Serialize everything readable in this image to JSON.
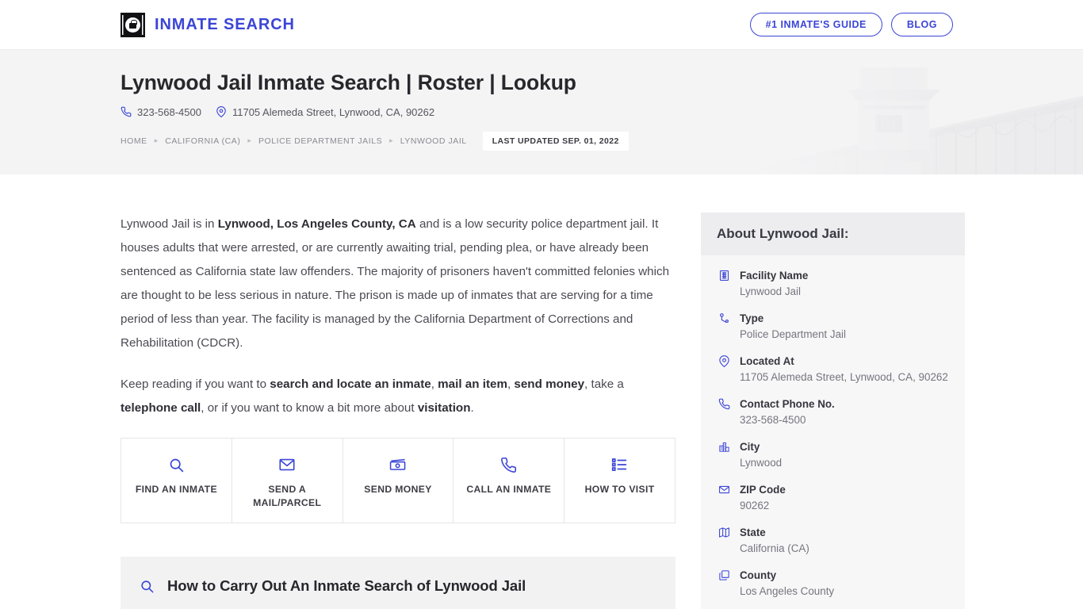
{
  "header": {
    "brand_name": "INMATE SEARCH",
    "logo_icon": "jail-bars-padlock-icon",
    "buttons": [
      {
        "label": "#1 INMATE'S GUIDE",
        "name": "inmates-guide-button"
      },
      {
        "label": "BLOG",
        "name": "blog-button"
      }
    ]
  },
  "hero": {
    "title": "Lynwood Jail Inmate Search | Roster | Lookup",
    "phone_icon": "phone-icon",
    "phone": "323-568-4500",
    "location_icon": "map-pin-icon",
    "address": "11705 Alemeda Street, Lynwood, CA, 90262",
    "breadcrumbs": [
      "HOME",
      "CALIFORNIA (CA)",
      "POLICE DEPARTMENT JAILS",
      "LYNWOOD JAIL"
    ],
    "separator": "▸",
    "last_updated": "LAST UPDATED SEP. 01, 2022",
    "background_art": "prison-watchtower-fence-image"
  },
  "main": {
    "paragraph1": {
      "p1": "Lynwood Jail is in ",
      "b1": "Lynwood, Los Angeles County, CA",
      "p2": " and is a low security police department jail. It houses adults that were arrested, or are currently awaiting trial, pending plea, or have already been sentenced as California state law offenders. The majority of prisoners haven't committed felonies which are thought to be less serious in nature. The prison is made up of inmates that are serving for a time period of less than year. The facility is managed by the California Department of Corrections and Rehabilitation (CDCR)."
    },
    "paragraph2": {
      "p1": "Keep reading if you want to ",
      "b1": "search and locate an inmate",
      "p2": ", ",
      "b2": "mail an item",
      "p3": ", ",
      "b3": "send money",
      "p4": ", take a ",
      "b4": "telephone call",
      "p5": ", or if you want to know a bit more about ",
      "b5": "visitation",
      "p6": "."
    },
    "tiles": [
      {
        "name": "find-an-inmate-tile",
        "icon": "search-icon",
        "label": "FIND AN INMATE"
      },
      {
        "name": "send-a-mail-parcel-tile",
        "icon": "envelope-icon",
        "label": "SEND A MAIL/PARCEL"
      },
      {
        "name": "send-money-tile",
        "icon": "banknote-icon",
        "label": "SEND MONEY"
      },
      {
        "name": "call-an-inmate-tile",
        "icon": "phone-icon",
        "label": "CALL AN INMATE"
      },
      {
        "name": "how-to-visit-tile",
        "icon": "list-icon",
        "label": "HOW TO VISIT"
      }
    ],
    "howto_section": {
      "icon": "search-icon",
      "heading": "How to Carry Out An Inmate Search of Lynwood Jail"
    }
  },
  "sidebar": {
    "card_title": "About Lynwood Jail:",
    "facts": [
      {
        "icon": "building-grid-icon",
        "label": "Facility Name",
        "value": "Lynwood Jail"
      },
      {
        "icon": "node-type-icon",
        "label": "Type",
        "value": "Police Department Jail"
      },
      {
        "icon": "map-pin-icon",
        "label": "Located At",
        "value": "11705 Alemeda Street, Lynwood, CA, 90262"
      },
      {
        "icon": "phone-icon",
        "label": "Contact Phone No.",
        "value": "323-568-4500"
      },
      {
        "icon": "city-buildings-icon",
        "label": "City",
        "value": "Lynwood"
      },
      {
        "icon": "envelope-icon",
        "label": "ZIP Code",
        "value": "90262"
      },
      {
        "icon": "folded-map-icon",
        "label": "State",
        "value": "California (CA)"
      },
      {
        "icon": "copy-layers-icon",
        "label": "County",
        "value": "Los Angeles County"
      }
    ]
  },
  "colors": {
    "accent": "#3b45d6",
    "hero_bg": "#f4f4f5",
    "card_bg": "#f7f7f8",
    "card_head_bg": "#ededef",
    "text": "#3f3f46"
  }
}
